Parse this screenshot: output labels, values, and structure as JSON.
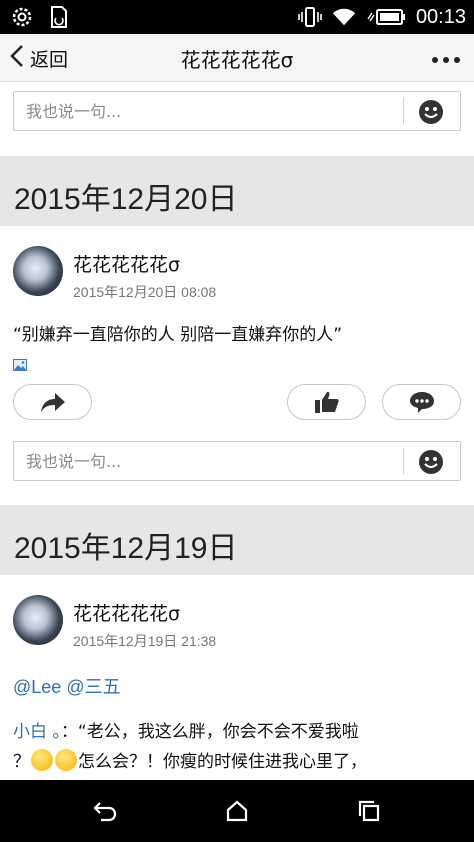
{
  "status_bar": {
    "time": "00:13",
    "left_icons": [
      "settings-icon",
      "sd-card-icon"
    ],
    "right_icons": [
      "vibrate-icon",
      "wifi-icon",
      "battery-icon"
    ]
  },
  "nav": {
    "back_label": "返回",
    "title": "花花花花花σ",
    "more_icon": "more-icon"
  },
  "comment_box": {
    "placeholder": "我也说一句..."
  },
  "posts": [
    {
      "date_header": "2015年12月20日",
      "author": "花花花花花σ",
      "timestamp": "2015年12月20日 08:08",
      "text": "“别嫌弃一直陪你的人 别陪一直嫌弃你的人”"
    },
    {
      "date_header": "2015年12月19日",
      "author": "花花花花花σ",
      "timestamp": "2015年12月19日 21:38",
      "mentions": [
        "@Lee",
        "@三五"
      ],
      "body_name": "小白 。",
      "body_line1": "：“老公，我这么胖，你会不会不爱我啦",
      "body_line2_prefix": "？",
      "body_line2_suffix": "怎么会？！你瘦的时候住进我心里了，"
    }
  ],
  "system_nav": [
    "back-icon",
    "home-icon",
    "recent-apps-icon"
  ]
}
